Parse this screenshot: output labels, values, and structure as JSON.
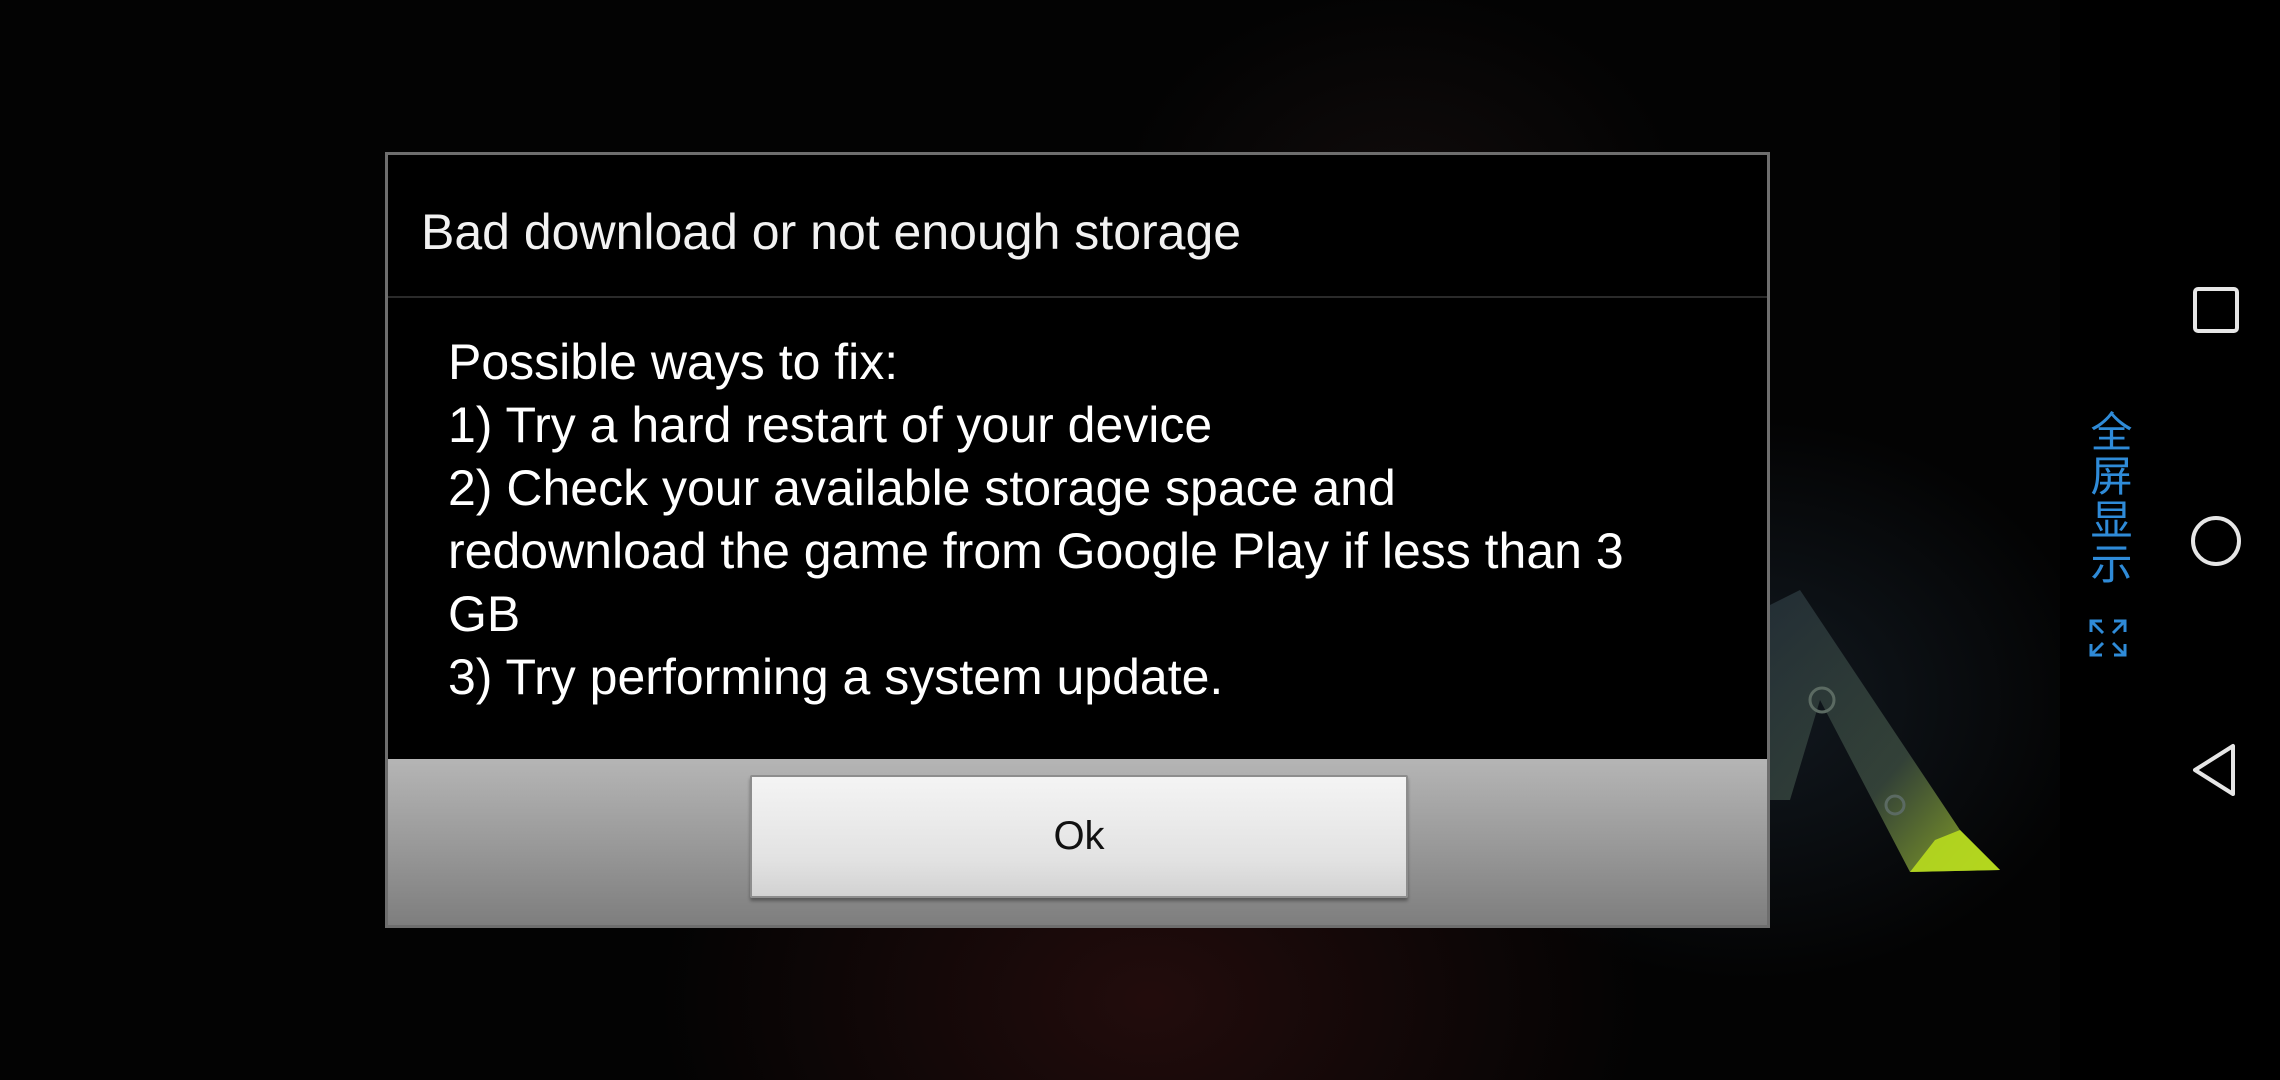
{
  "dialog": {
    "title": "Bad download or not enough storage",
    "body_lines": [
      "Possible ways to fix:",
      "1) Try a hard restart of your device",
      "2) Check your available storage space and",
      "redownload the game from Google Play if less than 3",
      "GB",
      "3) Try performing a system update."
    ],
    "ok_label": "Ok"
  },
  "side_panel": {
    "fullscreen_label": "全屏显示",
    "icons": [
      "expand-icon",
      "recents-icon",
      "home-icon",
      "back-icon"
    ],
    "accent_color": "#2f8bd8"
  }
}
